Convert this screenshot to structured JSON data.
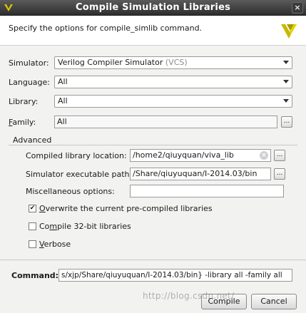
{
  "window": {
    "title": "Compile Simulation Libraries",
    "close_glyph": "×"
  },
  "header": {
    "description": "Specify the options for compile_simlib command."
  },
  "colors": {
    "titlebar": "#3a3a3a",
    "logo": "#c9b800",
    "panel": "#f2f2f0"
  },
  "icons": {
    "window": "app-icon",
    "logo": "vivado-logo-icon",
    "close": "close-icon",
    "dropdown": "chevron-down-icon",
    "clear": "clear-icon",
    "browse": "ellipsis-icon",
    "check": "checkmark-icon"
  },
  "form": {
    "simulator": {
      "label": "Simulator:",
      "value": "Verilog Compiler Simulator",
      "value_suffix": "(VCS)"
    },
    "language": {
      "label": "Language:",
      "value": "All"
    },
    "library": {
      "label": "Library:",
      "value": "All"
    },
    "family": {
      "label_prefix": "",
      "label_mnemonic": "F",
      "label_rest": "amily:",
      "value": "All",
      "browse_label": "..."
    }
  },
  "advanced": {
    "heading": "Advanced",
    "compiled_location": {
      "label": "Compiled library location:",
      "value": "/home2/qiuyquan/viva_lib",
      "browse_label": "..."
    },
    "sim_exec_path": {
      "label": "Simulator executable path:",
      "value": "/Share/qiuyuquan/I-2014.03/bin",
      "browse_label": "..."
    },
    "misc_options": {
      "label": "Miscellaneous options:",
      "value": ""
    },
    "overwrite": {
      "mnemonic": "O",
      "rest": "verwrite the current pre-compiled libraries",
      "checked": true
    },
    "compile32": {
      "prefix": "Co",
      "mnemonic": "m",
      "rest": "pile 32-bit libraries",
      "checked": false
    },
    "verbose": {
      "mnemonic": "V",
      "rest": "erbose",
      "checked": false
    }
  },
  "command": {
    "label": "Command:",
    "value": "s/xjp/Share/qiuyuquan/I-2014.03/bin} -library all -family all"
  },
  "buttons": {
    "ok": "Compile",
    "cancel": "Cancel"
  },
  "watermark": {
    "url": "http://blog.csdn.net/"
  }
}
